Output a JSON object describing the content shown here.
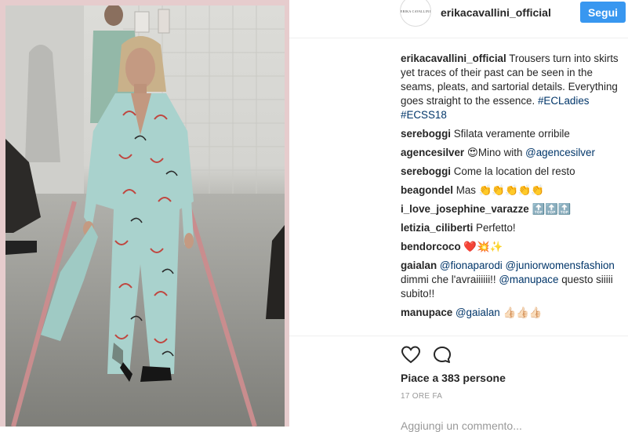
{
  "post": {
    "username": "erikacavallini_official",
    "avatar_text": "ERIKA CAVALLINI",
    "follow_label": "Segui"
  },
  "caption": {
    "user": "erikacavallini_official",
    "text": "Trousers turn into skirts yet traces of their past can be seen in the seams, pleats, and sartorial details. Everything goes straight to the essence.",
    "tags": "#ECLadies #ECSS18"
  },
  "comments": [
    {
      "user": "sereboggi",
      "text": "Sfilata veramente orribile"
    },
    {
      "user": "agencesilver",
      "pre": "😍Mino with ",
      "mention": "@agencesilver"
    },
    {
      "user": "sereboggi",
      "text": "Come la location del resto"
    },
    {
      "user": "beagondel",
      "text": "Mas 👏👏👏👏👏"
    },
    {
      "user": "i_love_josephine_varazze",
      "text": "🔝🔝🔝"
    },
    {
      "user": "letizia_ciliberti",
      "text": "Perfetto!"
    },
    {
      "user": "bendorcoco",
      "text": "❤️💥✨"
    },
    {
      "user": "gaialan",
      "m1": "@fionaparodi",
      "m2": "@juniorwomensfashion",
      "t1": " dimmi che l'avraiiiiii!! ",
      "m3": "@manupace",
      "t2": " questo siiiii subito!!"
    },
    {
      "user": "manupace",
      "mention": "@gaialan",
      "text": " 👍🏻👍🏻👍🏻"
    }
  ],
  "likes_text": "Piace a 383 persone",
  "timestamp": "17 ORE FA",
  "add_comment_placeholder": "Aggiungi un commento...",
  "colors": {
    "follow_button": "#3897f0",
    "link": "#003569",
    "frame": "#e6cccd"
  }
}
